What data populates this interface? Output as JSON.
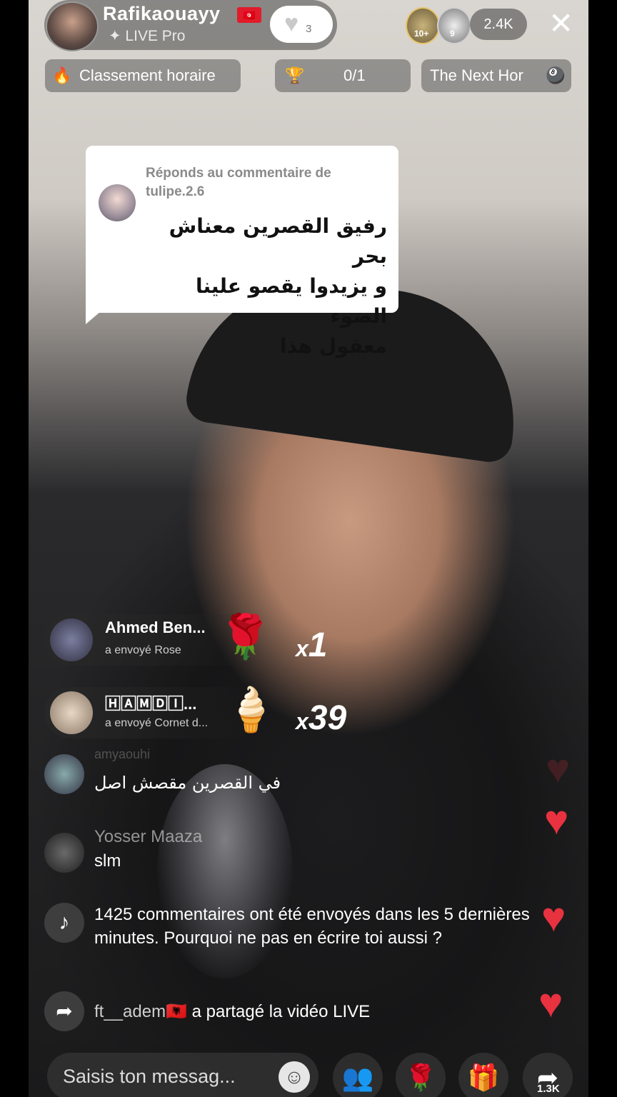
{
  "header": {
    "host_name": "Rafikaouayy",
    "host_flag": "🇹🇳",
    "host_badge": "✦ LIVE Pro",
    "like_count": "3",
    "ranker_1_level": "10+",
    "ranker_2_level": "9",
    "viewer_count": "2.4K",
    "close_label": "✕"
  },
  "chips": {
    "hourly_ranking": "Classement horaire",
    "progress": "0/1",
    "next_hour": "The Next Hor"
  },
  "pinned_comment": {
    "reply_label": "Réponds au commentaire de tulipe.2.6",
    "text_line1": "رفيق القصرين معناش بحر",
    "text_line2": "و يزيدوا يقصو علينا الضوء",
    "text_line3": "معقول هذا"
  },
  "gifts": [
    {
      "sender": "Ahmed Ben...",
      "sent_text": "a envoyé  Rose",
      "icon": "🌹",
      "multiplier": "x",
      "count": "1"
    },
    {
      "sender": "🄷🄰🄼🄳🄸...",
      "sent_text": "a envoyé  Cornet d...",
      "icon": "🍦",
      "multiplier": "x",
      "count": "39"
    }
  ],
  "chat": [
    {
      "name": "amyaouhi",
      "text": "في القصرين مقصش اصل"
    },
    {
      "name": "Yosser Maaza",
      "text": "slm"
    }
  ],
  "system_message": {
    "icon": "♪",
    "text": "1425 commentaires ont été envoyés dans les 5 dernières minutes. Pourquoi ne pas en écrire toi aussi ?"
  },
  "share_message": {
    "user": "ft__adem",
    "flag": "🇦🇱",
    "text": " a partagé la vidéo LIVE"
  },
  "bottom": {
    "placeholder": "Saisis ton messag...",
    "emoji": "☺",
    "share_count": "1.3K"
  },
  "colors": {
    "heart": "#e8323f",
    "flag_red": "#e21b2a",
    "card_bg": "#ffffff"
  }
}
